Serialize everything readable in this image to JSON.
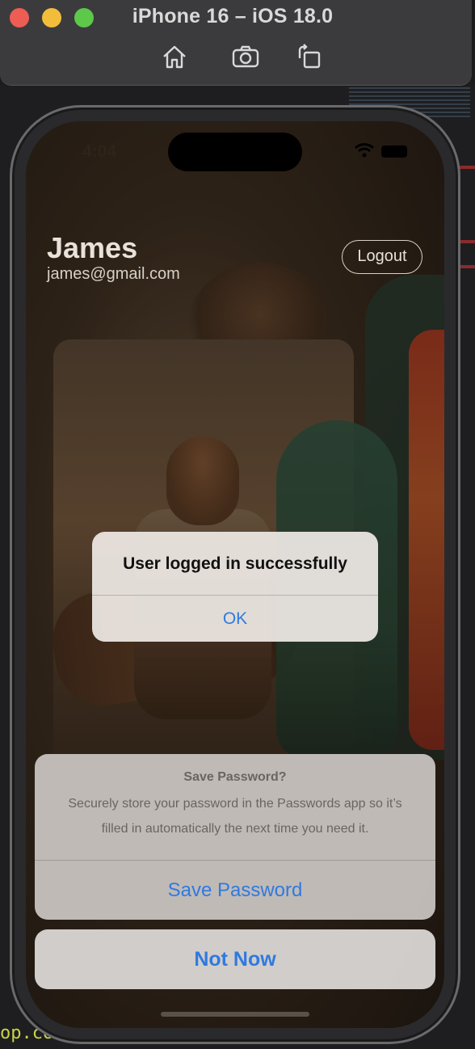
{
  "simulator": {
    "title": "iPhone 16 – iOS 18.0",
    "toolbar": [
      "home-icon",
      "camera-icon",
      "rotate-icon"
    ]
  },
  "status_bar": {
    "time": "4:04"
  },
  "header": {
    "name": "James",
    "email": "james@gmail.com",
    "logout_label": "Logout"
  },
  "alert": {
    "title": "User logged in successfully",
    "ok_label": "OK"
  },
  "save_password_sheet": {
    "title": "Save Password?",
    "message": "Securely store your password in the Passwords app so it’s filled in automatically the next time you need it.",
    "save_label": "Save Password",
    "cancel_label": "Not Now"
  },
  "background_code": {
    "text": "op.com"
  },
  "colors": {
    "accent": "#2f7ae0",
    "traffic_red": "#ee5d54",
    "traffic_yellow": "#f3bd3c",
    "traffic_green": "#5dc849"
  }
}
